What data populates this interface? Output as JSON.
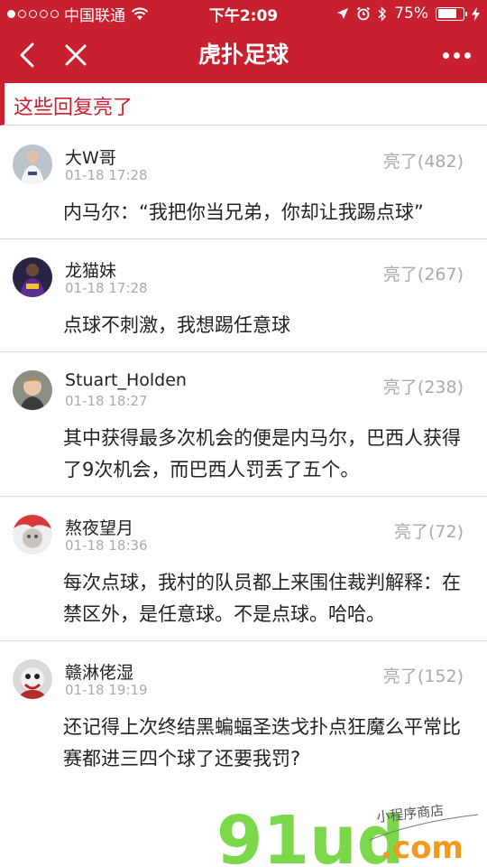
{
  "status_bar": {
    "carrier": "中国联通",
    "time": "下午2:09",
    "battery": "75%",
    "battery_level": 0.75
  },
  "nav": {
    "title": "虎扑足球"
  },
  "section": {
    "title": "这些回复亮了"
  },
  "comments": [
    {
      "user": "大W哥",
      "time": "01-18 17:28",
      "likes": "亮了(482)",
      "content": "内马尔：“我把你当兄弟，你却让我踢点球”"
    },
    {
      "user": "龙猫妹",
      "time": "01-18 17:28",
      "likes": "亮了(267)",
      "content": "点球不刺激，我想踢任意球"
    },
    {
      "user": "Stuart_Holden",
      "time": "01-18 18:27",
      "likes": "亮了(238)",
      "content": "其中获得最多次机会的便是内马尔，巴西人获得了9次机会，而巴西人罚丢了五个。"
    },
    {
      "user": "熬夜望月",
      "time": "01-18 18:36",
      "likes": "亮了(72)",
      "content": "每次点球，我村的队员都上来围住裁判解释：在禁区外，是任意球。不是点球。哈哈。"
    },
    {
      "user": "赣淋佬湿",
      "time": "01-18 19:19",
      "likes": "亮了(152)",
      "content": "还记得上次终结黑蝙蝠圣迭戈扑点狂魔么平常比赛都进三四个球了还要我罚?"
    }
  ],
  "watermark": {
    "logo": "91ud",
    "domain": ".com",
    "tagline": "小程序商店"
  },
  "colors": {
    "brand": "#c8202e",
    "muted": "#aaaaaa"
  }
}
